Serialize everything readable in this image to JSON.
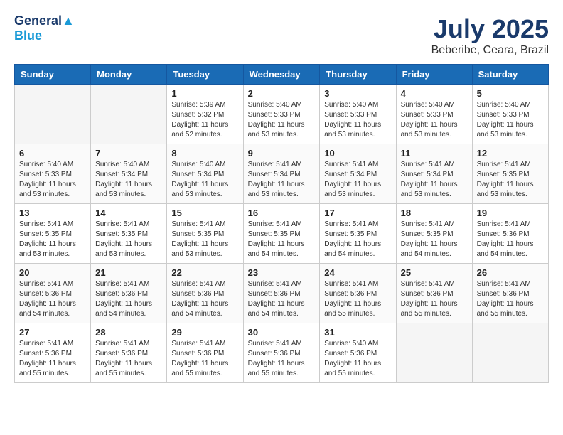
{
  "header": {
    "logo_line1": "General",
    "logo_line2": "Blue",
    "month_title": "July 2025",
    "subtitle": "Beberibe, Ceara, Brazil"
  },
  "days_of_week": [
    "Sunday",
    "Monday",
    "Tuesday",
    "Wednesday",
    "Thursday",
    "Friday",
    "Saturday"
  ],
  "weeks": [
    [
      {
        "day": "",
        "sunrise": "",
        "sunset": "",
        "daylight": ""
      },
      {
        "day": "",
        "sunrise": "",
        "sunset": "",
        "daylight": ""
      },
      {
        "day": "1",
        "sunrise": "Sunrise: 5:39 AM",
        "sunset": "Sunset: 5:32 PM",
        "daylight": "Daylight: 11 hours and 52 minutes."
      },
      {
        "day": "2",
        "sunrise": "Sunrise: 5:40 AM",
        "sunset": "Sunset: 5:33 PM",
        "daylight": "Daylight: 11 hours and 53 minutes."
      },
      {
        "day": "3",
        "sunrise": "Sunrise: 5:40 AM",
        "sunset": "Sunset: 5:33 PM",
        "daylight": "Daylight: 11 hours and 53 minutes."
      },
      {
        "day": "4",
        "sunrise": "Sunrise: 5:40 AM",
        "sunset": "Sunset: 5:33 PM",
        "daylight": "Daylight: 11 hours and 53 minutes."
      },
      {
        "day": "5",
        "sunrise": "Sunrise: 5:40 AM",
        "sunset": "Sunset: 5:33 PM",
        "daylight": "Daylight: 11 hours and 53 minutes."
      }
    ],
    [
      {
        "day": "6",
        "sunrise": "Sunrise: 5:40 AM",
        "sunset": "Sunset: 5:33 PM",
        "daylight": "Daylight: 11 hours and 53 minutes."
      },
      {
        "day": "7",
        "sunrise": "Sunrise: 5:40 AM",
        "sunset": "Sunset: 5:34 PM",
        "daylight": "Daylight: 11 hours and 53 minutes."
      },
      {
        "day": "8",
        "sunrise": "Sunrise: 5:40 AM",
        "sunset": "Sunset: 5:34 PM",
        "daylight": "Daylight: 11 hours and 53 minutes."
      },
      {
        "day": "9",
        "sunrise": "Sunrise: 5:41 AM",
        "sunset": "Sunset: 5:34 PM",
        "daylight": "Daylight: 11 hours and 53 minutes."
      },
      {
        "day": "10",
        "sunrise": "Sunrise: 5:41 AM",
        "sunset": "Sunset: 5:34 PM",
        "daylight": "Daylight: 11 hours and 53 minutes."
      },
      {
        "day": "11",
        "sunrise": "Sunrise: 5:41 AM",
        "sunset": "Sunset: 5:34 PM",
        "daylight": "Daylight: 11 hours and 53 minutes."
      },
      {
        "day": "12",
        "sunrise": "Sunrise: 5:41 AM",
        "sunset": "Sunset: 5:35 PM",
        "daylight": "Daylight: 11 hours and 53 minutes."
      }
    ],
    [
      {
        "day": "13",
        "sunrise": "Sunrise: 5:41 AM",
        "sunset": "Sunset: 5:35 PM",
        "daylight": "Daylight: 11 hours and 53 minutes."
      },
      {
        "day": "14",
        "sunrise": "Sunrise: 5:41 AM",
        "sunset": "Sunset: 5:35 PM",
        "daylight": "Daylight: 11 hours and 53 minutes."
      },
      {
        "day": "15",
        "sunrise": "Sunrise: 5:41 AM",
        "sunset": "Sunset: 5:35 PM",
        "daylight": "Daylight: 11 hours and 53 minutes."
      },
      {
        "day": "16",
        "sunrise": "Sunrise: 5:41 AM",
        "sunset": "Sunset: 5:35 PM",
        "daylight": "Daylight: 11 hours and 54 minutes."
      },
      {
        "day": "17",
        "sunrise": "Sunrise: 5:41 AM",
        "sunset": "Sunset: 5:35 PM",
        "daylight": "Daylight: 11 hours and 54 minutes."
      },
      {
        "day": "18",
        "sunrise": "Sunrise: 5:41 AM",
        "sunset": "Sunset: 5:35 PM",
        "daylight": "Daylight: 11 hours and 54 minutes."
      },
      {
        "day": "19",
        "sunrise": "Sunrise: 5:41 AM",
        "sunset": "Sunset: 5:36 PM",
        "daylight": "Daylight: 11 hours and 54 minutes."
      }
    ],
    [
      {
        "day": "20",
        "sunrise": "Sunrise: 5:41 AM",
        "sunset": "Sunset: 5:36 PM",
        "daylight": "Daylight: 11 hours and 54 minutes."
      },
      {
        "day": "21",
        "sunrise": "Sunrise: 5:41 AM",
        "sunset": "Sunset: 5:36 PM",
        "daylight": "Daylight: 11 hours and 54 minutes."
      },
      {
        "day": "22",
        "sunrise": "Sunrise: 5:41 AM",
        "sunset": "Sunset: 5:36 PM",
        "daylight": "Daylight: 11 hours and 54 minutes."
      },
      {
        "day": "23",
        "sunrise": "Sunrise: 5:41 AM",
        "sunset": "Sunset: 5:36 PM",
        "daylight": "Daylight: 11 hours and 54 minutes."
      },
      {
        "day": "24",
        "sunrise": "Sunrise: 5:41 AM",
        "sunset": "Sunset: 5:36 PM",
        "daylight": "Daylight: 11 hours and 55 minutes."
      },
      {
        "day": "25",
        "sunrise": "Sunrise: 5:41 AM",
        "sunset": "Sunset: 5:36 PM",
        "daylight": "Daylight: 11 hours and 55 minutes."
      },
      {
        "day": "26",
        "sunrise": "Sunrise: 5:41 AM",
        "sunset": "Sunset: 5:36 PM",
        "daylight": "Daylight: 11 hours and 55 minutes."
      }
    ],
    [
      {
        "day": "27",
        "sunrise": "Sunrise: 5:41 AM",
        "sunset": "Sunset: 5:36 PM",
        "daylight": "Daylight: 11 hours and 55 minutes."
      },
      {
        "day": "28",
        "sunrise": "Sunrise: 5:41 AM",
        "sunset": "Sunset: 5:36 PM",
        "daylight": "Daylight: 11 hours and 55 minutes."
      },
      {
        "day": "29",
        "sunrise": "Sunrise: 5:41 AM",
        "sunset": "Sunset: 5:36 PM",
        "daylight": "Daylight: 11 hours and 55 minutes."
      },
      {
        "day": "30",
        "sunrise": "Sunrise: 5:41 AM",
        "sunset": "Sunset: 5:36 PM",
        "daylight": "Daylight: 11 hours and 55 minutes."
      },
      {
        "day": "31",
        "sunrise": "Sunrise: 5:40 AM",
        "sunset": "Sunset: 5:36 PM",
        "daylight": "Daylight: 11 hours and 55 minutes."
      },
      {
        "day": "",
        "sunrise": "",
        "sunset": "",
        "daylight": ""
      },
      {
        "day": "",
        "sunrise": "",
        "sunset": "",
        "daylight": ""
      }
    ]
  ]
}
